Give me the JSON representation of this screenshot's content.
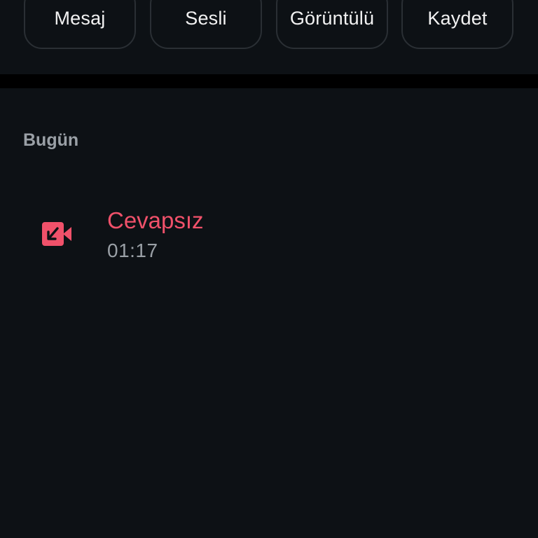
{
  "actions": {
    "message_label": "Mesaj",
    "voice_label": "Sesli",
    "video_label": "Görüntülü",
    "save_label": "Kaydet"
  },
  "history": {
    "section_title": "Bugün",
    "calls": [
      {
        "status": "Cevapsız",
        "time": "01:17",
        "icon": "missed-video-call-icon"
      }
    ]
  },
  "colors": {
    "background": "#0d1115",
    "missed": "#f0516a",
    "secondary_text": "#9aa0a6",
    "button_border": "#2a2f34"
  }
}
